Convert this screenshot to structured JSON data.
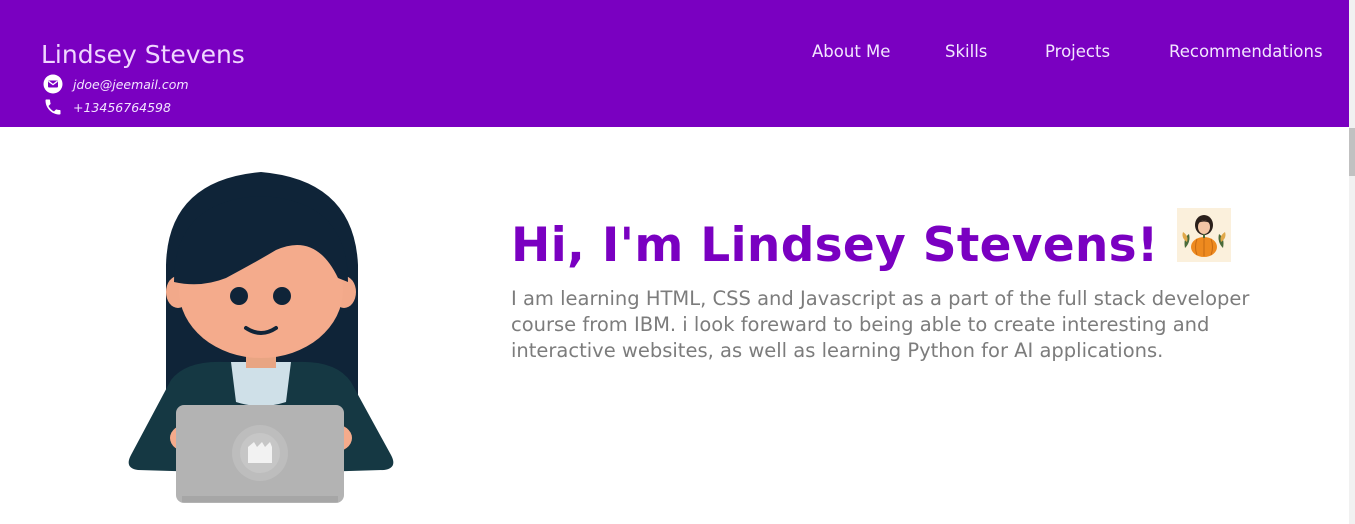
{
  "header": {
    "name": "Lindsey Stevens",
    "email": "jdoe@jeemail.com",
    "phone": "+13456764598",
    "email_icon": "mail-icon",
    "phone_icon": "phone-icon",
    "background_color": "#7a00c1"
  },
  "nav": {
    "items": [
      {
        "label": "About Me"
      },
      {
        "label": "Skills"
      },
      {
        "label": "Projects"
      },
      {
        "label": "Recommendations"
      }
    ]
  },
  "hero": {
    "title": "Hi, I'm Lindsey Stevens!",
    "description": "I am learning HTML, CSS and Javascript as a part of the full stack developer course from IBM. i look foreward to being able to create interesting and interactive websites, as well as learning Python for AI applications.",
    "title_color": "#7a00c1",
    "avatar_icon": "developer-avatar-illustration",
    "badge_icon": "girl-with-pumpkin-sticker"
  }
}
